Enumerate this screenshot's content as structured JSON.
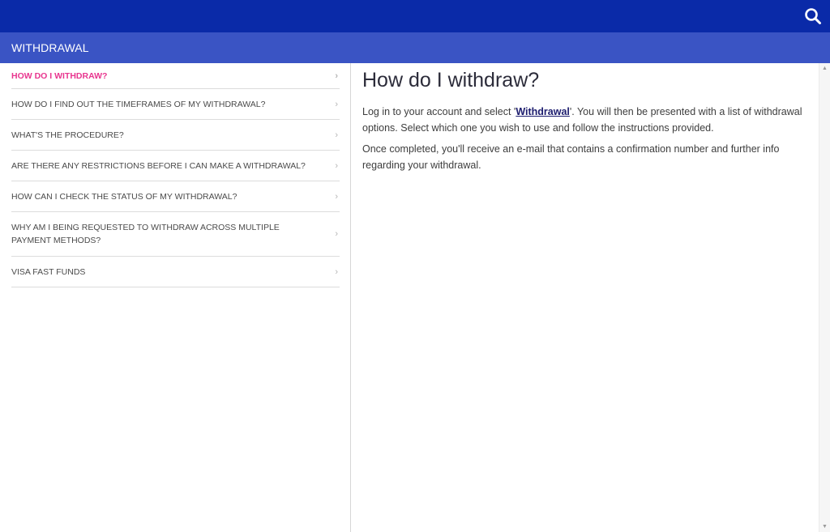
{
  "header": {
    "search_icon": "search-icon",
    "bg_color": "#0a2aa8"
  },
  "section": {
    "title": "WITHDRAWAL",
    "bg_color": "#3a54c4"
  },
  "faq": {
    "active_color": "#e8368f",
    "items": [
      {
        "label": "HOW DO I WITHDRAW?"
      },
      {
        "label": "HOW DO I FIND OUT THE TIMEFRAMES OF MY WITHDRAWAL?"
      },
      {
        "label": "WHAT'S THE PROCEDURE?"
      },
      {
        "label": "ARE THERE ANY RESTRICTIONS BEFORE I CAN MAKE A WITHDRAWAL?"
      },
      {
        "label": "HOW CAN I CHECK THE STATUS OF MY WITHDRAWAL?"
      },
      {
        "label": "WHY AM I BEING REQUESTED TO WITHDRAW ACROSS MULTIPLE PAYMENT METHODS?"
      },
      {
        "label": "VISA FAST FUNDS"
      }
    ]
  },
  "article": {
    "title": "How do I withdraw?",
    "p1_before": "Log in to your account and select '",
    "p1_link": "Withdrawal",
    "p1_after": "'. You will then be presented with a list of withdrawal options. Select which one you wish to use and follow the instructions provided.",
    "p2": "Once completed, you'll receive an e-mail that contains a confirmation number and further info regarding your withdrawal."
  }
}
